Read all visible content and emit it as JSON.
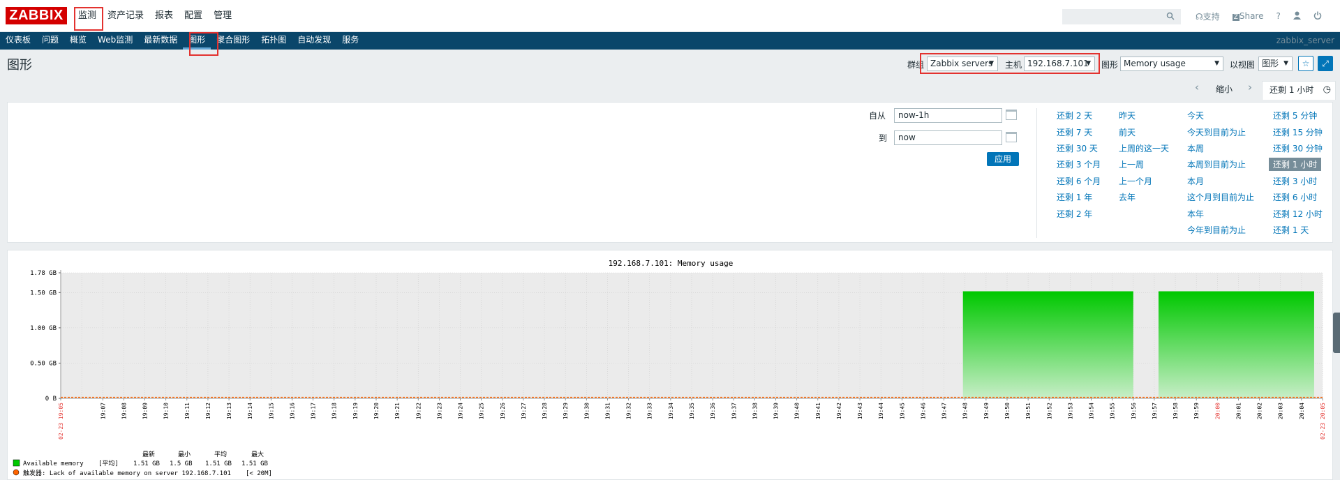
{
  "logo": "ZABBIX",
  "main_menu": [
    "监测",
    "资产记录",
    "报表",
    "配置",
    "管理"
  ],
  "top_links": {
    "support": "支持",
    "share": "Share",
    "help": "?"
  },
  "sub_menu": [
    "仪表板",
    "问题",
    "概览",
    "Web监测",
    "最新数据",
    "图形",
    "聚合图形",
    "拓扑图",
    "自动发现",
    "服务"
  ],
  "server_name": "zabbix_server",
  "page_title": "图形",
  "filters": {
    "group_label": "群组",
    "group_value": "Zabbix servers",
    "host_label": "主机",
    "host_value": "192.168.7.101",
    "graph_label": "图形",
    "graph_value": "Memory usage",
    "view_label": "以视图",
    "view_value": "图形"
  },
  "timeline": {
    "zoom_out": "缩小",
    "selected_tab": "还剩 1 小时"
  },
  "timepicker": {
    "from_label": "自从",
    "from_value": "now-1h",
    "to_label": "到",
    "to_value": "now",
    "apply": "应用",
    "quick_col1": [
      "还剩 2 天",
      "还剩 7 天",
      "还剩 30 天",
      "还剩 3 个月",
      "还剩 6 个月",
      "还剩 1 年",
      "还剩 2 年"
    ],
    "quick_col2": [
      "昨天",
      "前天",
      "上周的这一天",
      "上一周",
      "上一个月",
      "去年"
    ],
    "quick_col3": [
      "今天",
      "今天到目前为止",
      "本周",
      "本周到目前为止",
      "本月",
      "这个月到目前为止",
      "本年",
      "今年到目前为止"
    ],
    "quick_col4": [
      "还剩 5 分钟",
      "还剩 15 分钟",
      "还剩 30 分钟",
      "还剩 1 小时",
      "还剩 3 小时",
      "还剩 6 小时",
      "还剩 12 小时",
      "还剩 1 天"
    ]
  },
  "chart_data": {
    "type": "area",
    "title": "192.168.7.101: Memory usage",
    "y_ticks": [
      "1.78 GB",
      "1.50 GB",
      "1.00 GB",
      "0.50 GB",
      "0 B"
    ],
    "ylim_gb": [
      0,
      1.78
    ],
    "x_start_label": "02-23 19:05",
    "x_end_label": "02-23 20:05",
    "x_minute_labels": [
      "19:07",
      "19:08",
      "19:09",
      "19:10",
      "19:11",
      "19:12",
      "19:13",
      "19:14",
      "19:15",
      "19:16",
      "19:17",
      "19:18",
      "19:19",
      "19:20",
      "19:21",
      "19:22",
      "19:23",
      "19:24",
      "19:25",
      "19:26",
      "19:27",
      "19:28",
      "19:29",
      "19:30",
      "19:31",
      "19:32",
      "19:33",
      "19:34",
      "19:35",
      "19:36",
      "19:37",
      "19:38",
      "19:39",
      "19:40",
      "19:41",
      "19:42",
      "19:43",
      "19:44",
      "19:45",
      "19:46",
      "19:47",
      "19:48",
      "19:49",
      "19:50",
      "19:51",
      "19:52",
      "19:53",
      "19:54",
      "19:55",
      "19:56",
      "19:57",
      "19:58",
      "19:59",
      "20:00",
      "20:01",
      "20:02",
      "20:03",
      "20:04",
      "20:05"
    ],
    "red_labels": [
      "20:00"
    ],
    "series": [
      {
        "name": "Available memory",
        "color": "#00c800",
        "segments": [
          {
            "from_min": 42.9,
            "to_min": 51.0,
            "value_gb": 1.51
          },
          {
            "from_min": 52.2,
            "to_min": 59.6,
            "value_gb": 1.51
          }
        ]
      }
    ],
    "legend_headers": [
      "最新",
      "最小",
      "平均",
      "最大"
    ],
    "legend_rows": [
      {
        "name": "Available memory",
        "func": "[平均]",
        "last": "1.51 GB",
        "min": "1.5 GB",
        "avg": "1.51 GB",
        "max": "1.51 GB"
      }
    ],
    "trigger": {
      "label": "触发器: Lack of available memory on server 192.168.7.101",
      "condition": "[< 20M]",
      "color": "#ff6400"
    },
    "grid": true
  }
}
